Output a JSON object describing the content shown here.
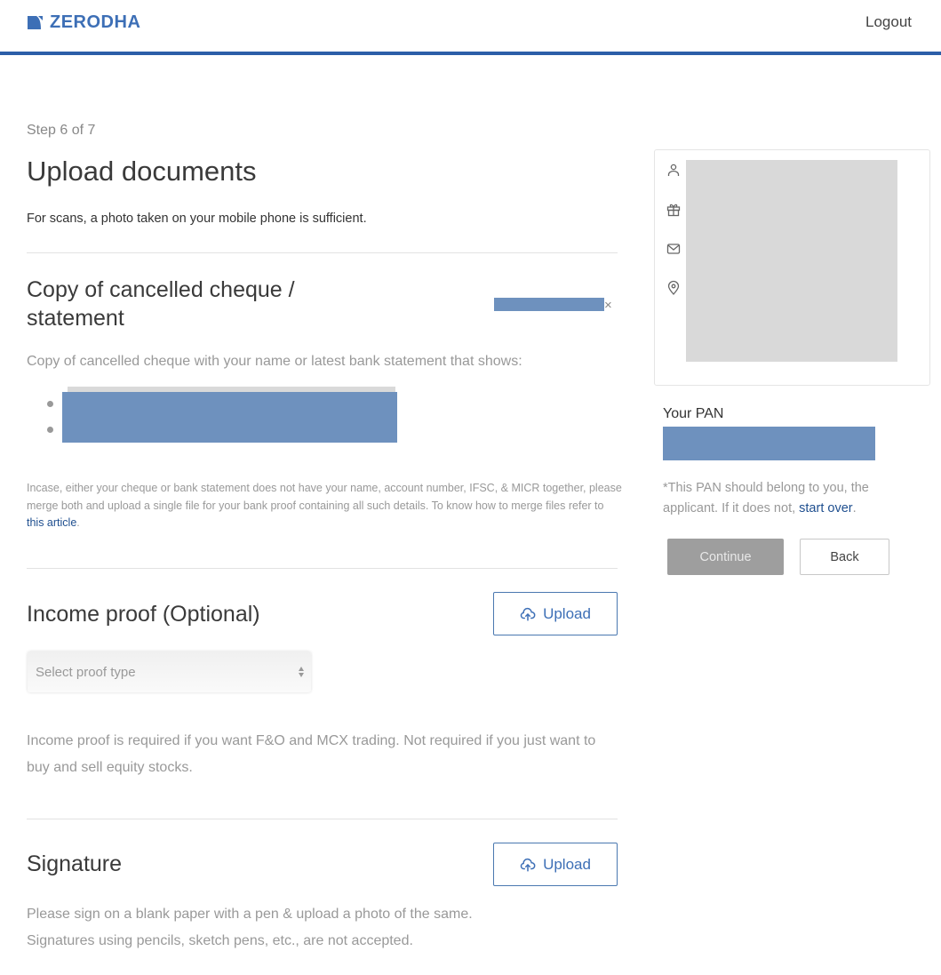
{
  "header": {
    "brand": "ZERODHA",
    "logout_label": "Logout",
    "brand_color": "#3d6fb6",
    "bar_color": "#2c5ea8"
  },
  "page": {
    "step": "Step 6 of 7",
    "title": "Upload documents",
    "subtitle": "For scans, a photo taken on your mobile phone is sufficient."
  },
  "bank_proof": {
    "title_line1": "Copy of cancelled cheque /",
    "title_line2": "statement",
    "uploaded_file": "[redacted]",
    "remove_icon": "close-icon",
    "remove_glyph": "×",
    "description": "Copy of cancelled cheque with your name or latest bank statement that shows:",
    "bullets": [
      "[redacted]",
      "[redacted]"
    ],
    "note_text": "Incase, either your cheque or bank statement does not have your name, account number, IFSC, & MICR together, please merge both and upload a single file for your bank proof containing all such details. To know how to merge files refer to ",
    "note_link": "this article",
    "note_end": "."
  },
  "income_proof": {
    "title": "Income proof (Optional)",
    "upload_label": "Upload",
    "upload_icon": "cloud-upload-icon",
    "select_placeholder": "Select proof type",
    "description": "Income proof is required if you want F&O and MCX trading. Not required if you just want to buy and sell equity stocks."
  },
  "signature": {
    "title": "Signature",
    "upload_label": "Upload",
    "upload_icon": "cloud-upload-icon",
    "description_line1": "Please sign on a blank paper with a pen & upload a photo of the same.",
    "description_line2": "Signatures using pencils, sketch pens, etc., are not accepted."
  },
  "sidebar": {
    "card_icons": [
      "user-icon",
      "gift-icon",
      "mail-icon",
      "location-pin-icon"
    ],
    "pan_label": "Your PAN",
    "pan_value": "[redacted]",
    "pan_note": "*This PAN should belong to you, the applicant. If it does not, ",
    "pan_note_link": "start over",
    "pan_note_end": ".",
    "continue_label": "Continue",
    "back_label": "Back"
  }
}
